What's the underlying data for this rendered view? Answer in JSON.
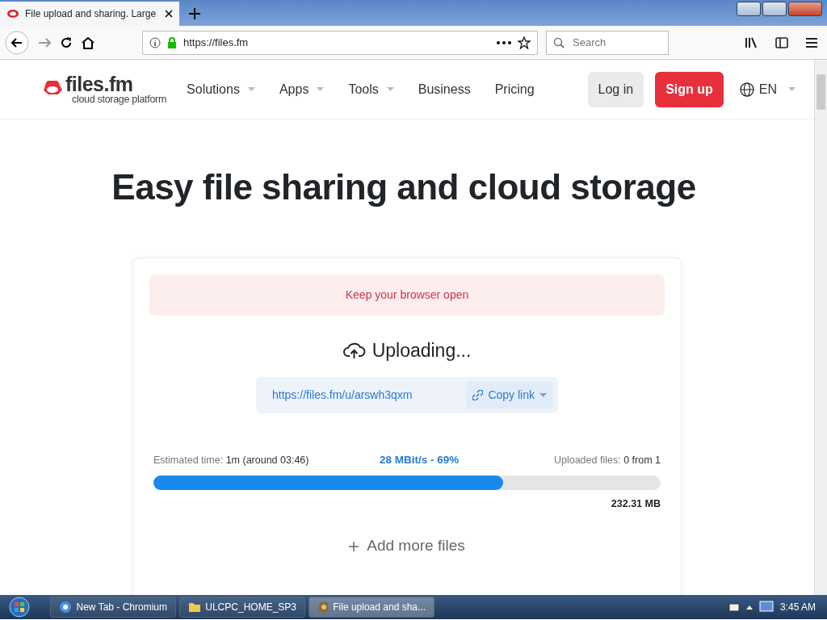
{
  "browser": {
    "tab": {
      "title": "File upload and sharing. Large"
    },
    "url": "https://files.fm",
    "search": {
      "placeholder": "Search"
    }
  },
  "site": {
    "logo": {
      "name": "files.fm",
      "tagline": "cloud storage platform"
    },
    "nav": [
      {
        "label": "Solutions",
        "dropdown": true
      },
      {
        "label": "Apps",
        "dropdown": true
      },
      {
        "label": "Tools",
        "dropdown": true
      },
      {
        "label": "Business",
        "dropdown": false
      },
      {
        "label": "Pricing",
        "dropdown": false
      }
    ],
    "login": "Log in",
    "signup": "Sign up",
    "language": "EN"
  },
  "heading": "Easy file sharing and cloud storage",
  "upload": {
    "alert": "Keep your browser open",
    "status": "Uploading...",
    "link": "https://files.fm/u/arswh3qxm",
    "copy_link": "Copy link",
    "estimated_label": "Estimated time:",
    "estimated_value": "1m (around 03:46)",
    "speed": "28 MBit/s - 69%",
    "uploaded_label": "Uploaded files:",
    "uploaded_value": "0 from 1",
    "level": 0.69,
    "size": "232.31 MB",
    "add_more": "Add more files"
  },
  "taskbar": {
    "items": [
      {
        "label": "New Tab - Chromium",
        "kind": "chromium",
        "selected": false
      },
      {
        "label": "ULCPC_HOME_SP3",
        "kind": "folder",
        "selected": false
      },
      {
        "label": "File upload and sha...",
        "kind": "firefox",
        "selected": true
      }
    ],
    "clock": "3:45 AM"
  }
}
